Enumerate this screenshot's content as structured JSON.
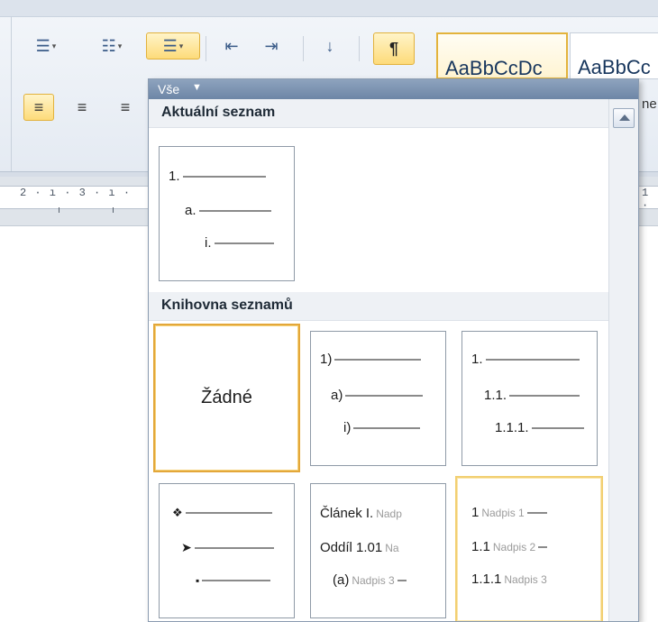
{
  "ribbon": {
    "styles": [
      "AaBbCcDc",
      "AaBbCc"
    ],
    "style_fragment": "ne"
  },
  "ruler": {
    "left_marks": "2 · ı · 3 · ı ·",
    "right_mark": "1 ·"
  },
  "gallery": {
    "filter_label": "Vše",
    "current_section": "Aktuální seznam",
    "library_section": "Knihovna seznamů",
    "current_list": [
      "1.",
      "a.",
      "i."
    ],
    "none_label": "Žádné",
    "list_paren": [
      "1)",
      "a)",
      "i)"
    ],
    "list_decimal": [
      "1.",
      "1.1.",
      "1.1.1."
    ],
    "list_bullets_icons": [
      "diamond-bullet-icon",
      "arrow-bullet-icon",
      "square-bullet-icon"
    ],
    "list_article": [
      {
        "num": "Článek I.",
        "tail": "Nadp"
      },
      {
        "num": "Oddíl 1.01",
        "tail": "Na"
      },
      {
        "num": "(a)",
        "tail": "Nadpis 3"
      }
    ],
    "list_heading": [
      {
        "num": "1",
        "tail": "Nadpis 1"
      },
      {
        "num": "1.1",
        "tail": "Nadpis 2"
      },
      {
        "num": "1.1.1",
        "tail": "Nadpis 3"
      }
    ]
  },
  "colors": {
    "accent": "#e3a73a",
    "header": "#7a90ae"
  }
}
